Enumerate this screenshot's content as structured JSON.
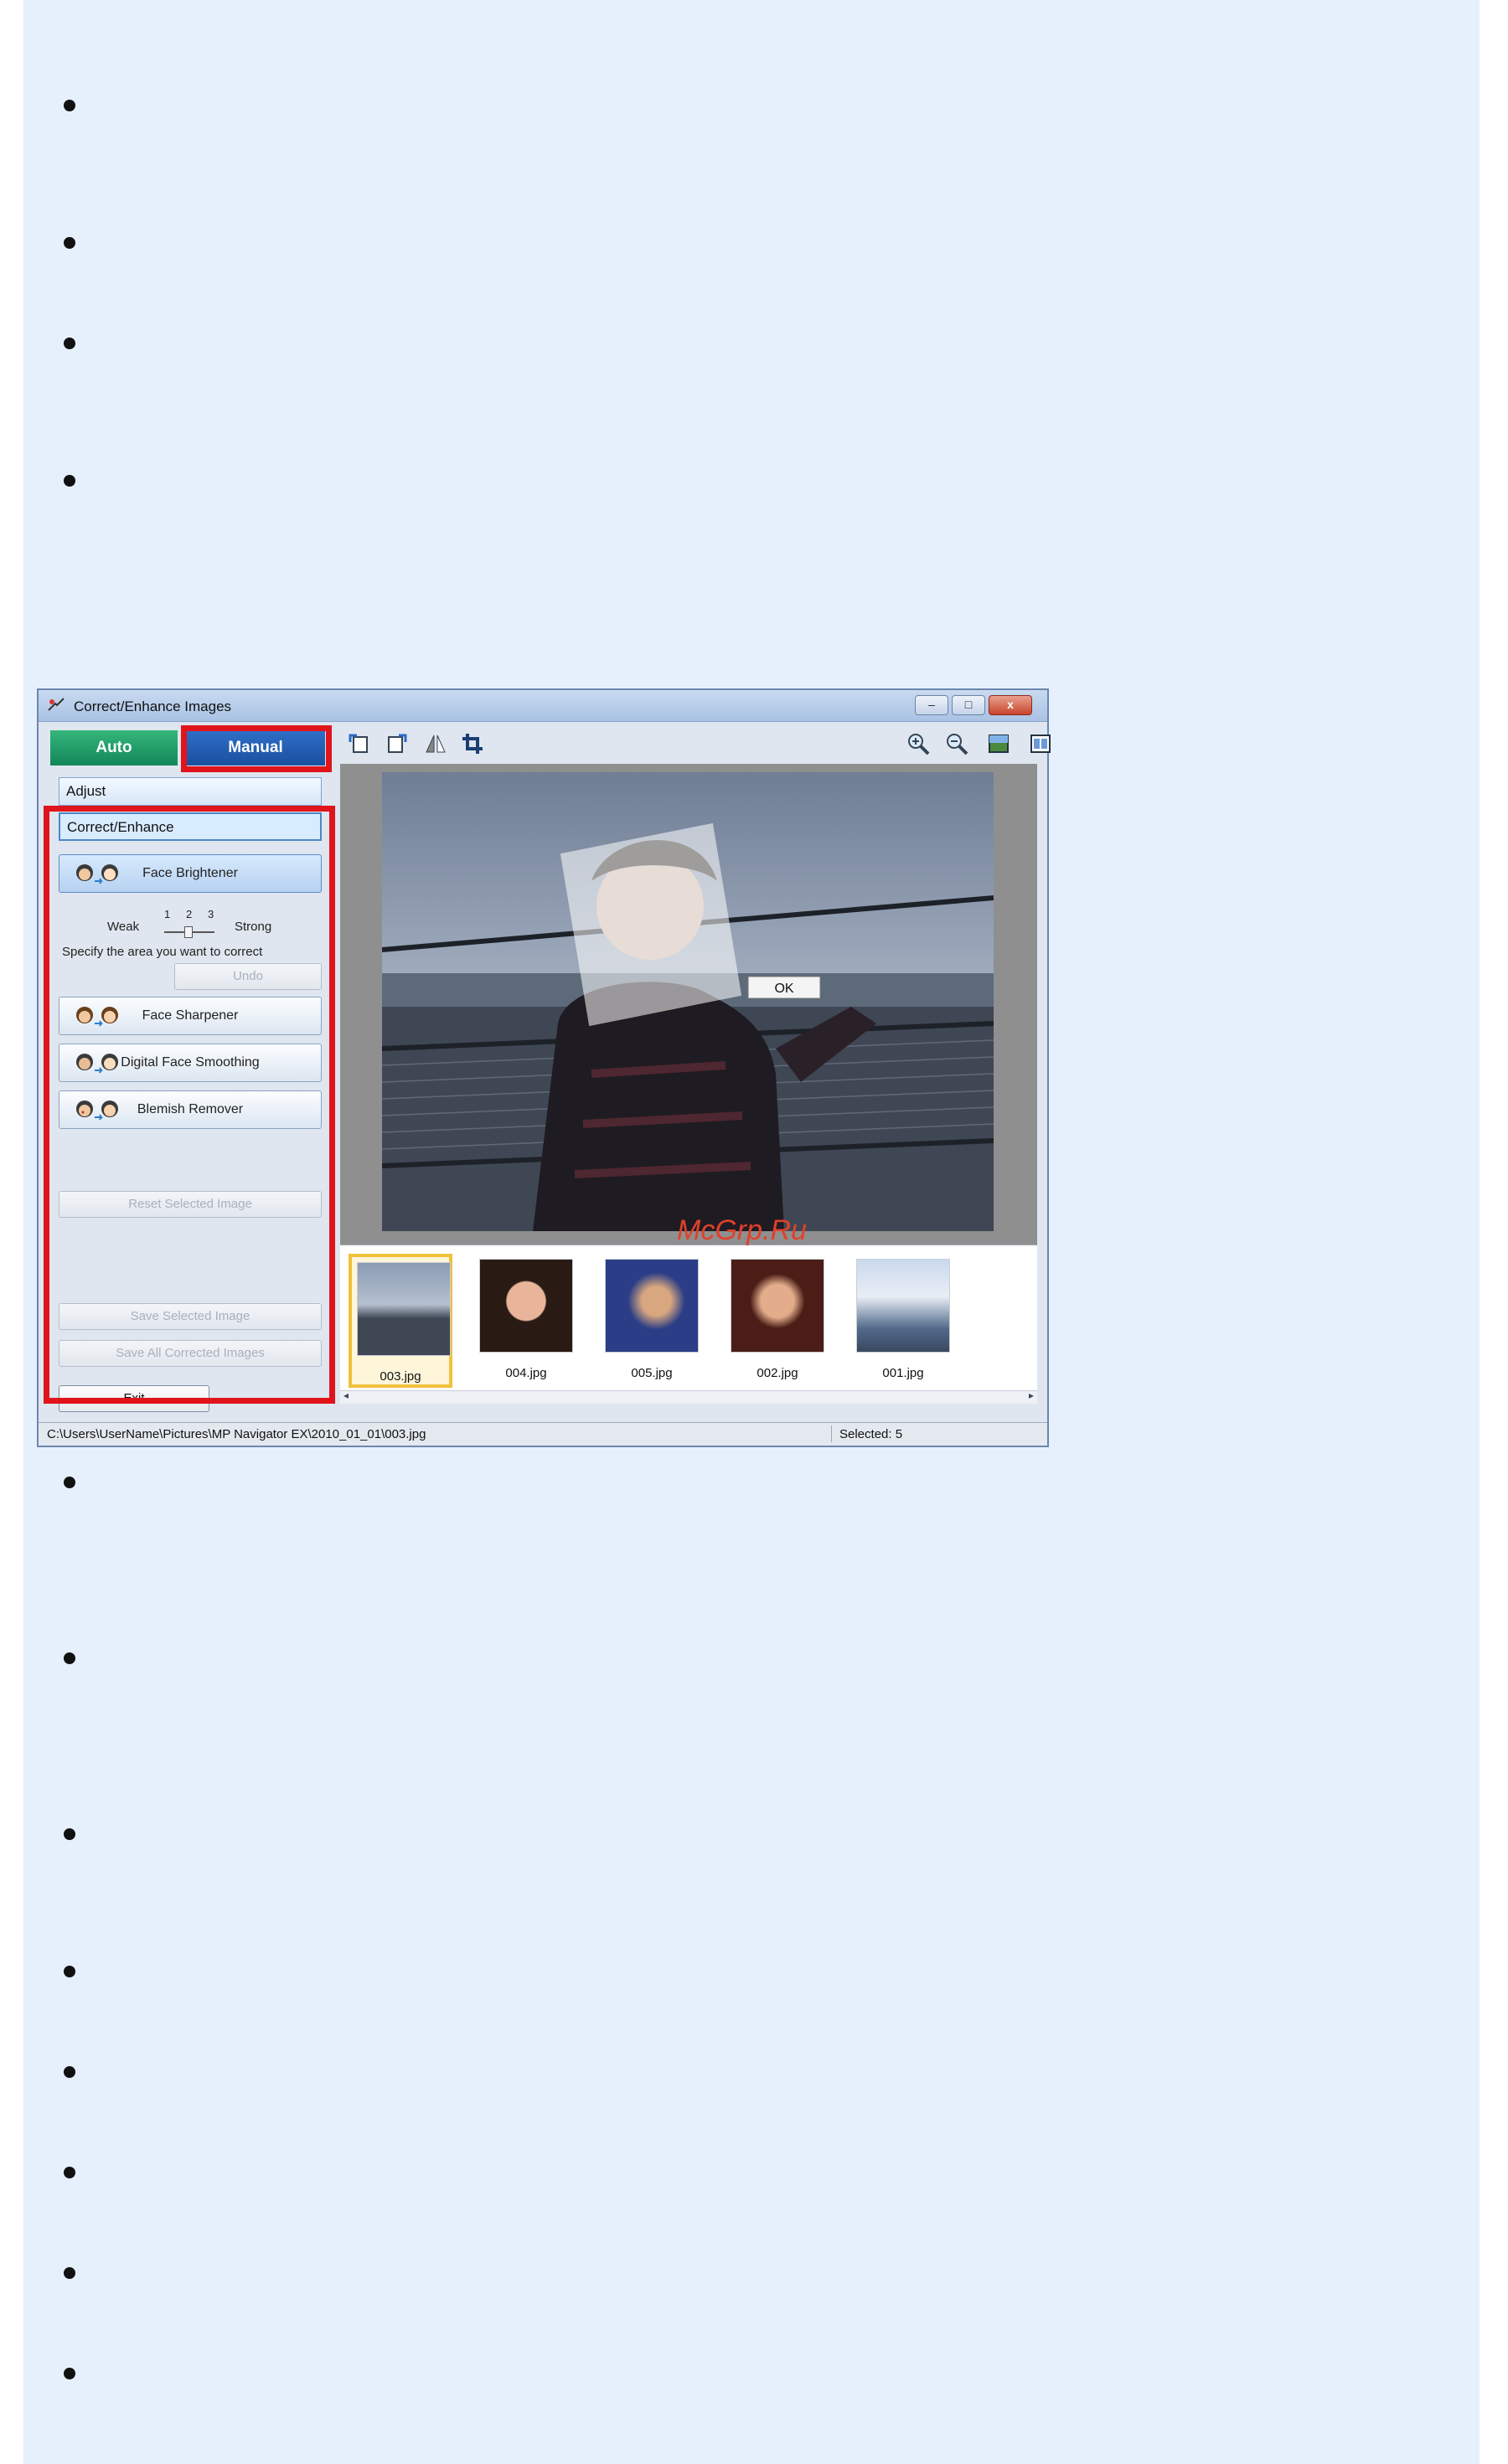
{
  "window": {
    "title": "Correct/Enhance Images",
    "controls": {
      "minimize": "–",
      "maximize": "□",
      "close": "x"
    }
  },
  "tabs": {
    "auto": "Auto",
    "manual": "Manual"
  },
  "sections": {
    "adjust": "Adjust",
    "correct": "Correct/Enhance"
  },
  "tools": {
    "face_brightener": "Face Brightener",
    "face_sharpener": "Face Sharpener",
    "digital_face_smoothing": "Digital Face Smoothing",
    "blemish_remover": "Blemish Remover"
  },
  "slider": {
    "weak": "Weak",
    "strong": "Strong",
    "tick1": "1",
    "tick2": "2",
    "tick3": "3",
    "level": 2
  },
  "hint": "Specify the area you want to correct",
  "buttons": {
    "undo": "Undo",
    "reset_selected": "Reset Selected Image",
    "save_selected": "Save Selected Image",
    "save_all": "Save All Corrected Images",
    "exit": "Exit",
    "ok": "OK"
  },
  "toolbar_icons": [
    "rotate-left-icon",
    "rotate-right-icon",
    "invert-icon",
    "trim-icon",
    "zoom-in-icon",
    "zoom-out-icon",
    "full-screen-icon",
    "compare-icon"
  ],
  "thumbnails": [
    {
      "name": "003.jpg",
      "selected": true
    },
    {
      "name": "004.jpg",
      "selected": false
    },
    {
      "name": "005.jpg",
      "selected": false
    },
    {
      "name": "002.jpg",
      "selected": false
    },
    {
      "name": "001.jpg",
      "selected": false
    }
  ],
  "status": {
    "path": "C:\\Users\\UserName\\Pictures\\MP Navigator EX\\2010_01_01\\003.jpg",
    "selected": "Selected: 5"
  },
  "watermark": "McGrp.Ru",
  "colors": {
    "panel_bg": "#e6f0fd",
    "highlight": "#e0141a",
    "auto_tab": "#1a9a68",
    "manual_tab": "#2462b8"
  }
}
